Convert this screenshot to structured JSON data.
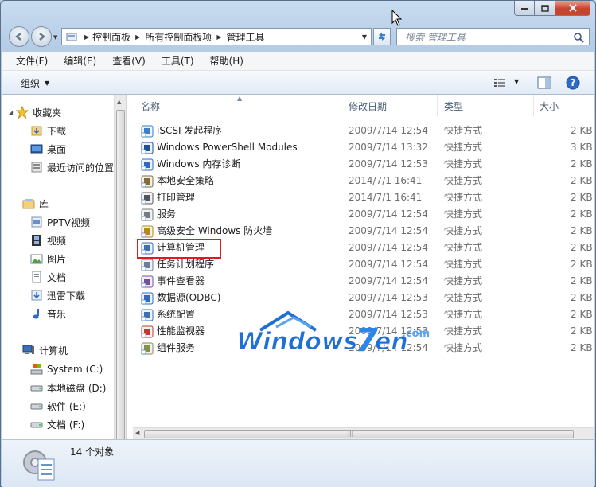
{
  "window": {
    "caption_buttons": [
      {
        "name": "minimize-button",
        "icon": "minimize-icon"
      },
      {
        "name": "maximize-button",
        "icon": "maximize-icon"
      },
      {
        "name": "close-button",
        "icon": "close-icon"
      }
    ]
  },
  "navigation": {
    "breadcrumb": [
      "控制面板",
      "所有控制面板项",
      "管理工具"
    ],
    "search_placeholder": "搜索 管理工具"
  },
  "menubar": {
    "items": [
      "文件(F)",
      "编辑(E)",
      "查看(V)",
      "工具(T)",
      "帮助(H)"
    ]
  },
  "commandbar": {
    "organize_label": "组织"
  },
  "navpane": {
    "favorites": {
      "label": "收藏夹",
      "items": [
        "下载",
        "桌面",
        "最近访问的位置"
      ]
    },
    "libraries": {
      "label": "库",
      "items": [
        "PPTV视频",
        "视频",
        "图片",
        "文档",
        "迅雷下载",
        "音乐"
      ]
    },
    "computer": {
      "label": "计算机",
      "items": [
        "System (C:)",
        "本地磁盘 (D:)",
        "软件 (E:)",
        "文档 (F:)"
      ]
    }
  },
  "filelist": {
    "columns": [
      "名称",
      "修改日期",
      "类型",
      "大小"
    ],
    "rows": [
      {
        "name": "iSCSI 发起程序",
        "date": "2009/7/14 12:54",
        "type": "快捷方式",
        "size": "2 KB",
        "icon": "iscsi-icon"
      },
      {
        "name": "Windows PowerShell Modules",
        "date": "2009/7/14 13:32",
        "type": "快捷方式",
        "size": "3 KB",
        "icon": "powershell-icon"
      },
      {
        "name": "Windows 内存诊断",
        "date": "2009/7/14 12:53",
        "type": "快捷方式",
        "size": "2 KB",
        "icon": "memory-diagnostic-icon"
      },
      {
        "name": "本地安全策略",
        "date": "2014/7/1 16:41",
        "type": "快捷方式",
        "size": "2 KB",
        "icon": "security-policy-icon"
      },
      {
        "name": "打印管理",
        "date": "2014/7/1 16:41",
        "type": "快捷方式",
        "size": "2 KB",
        "icon": "printer-icon"
      },
      {
        "name": "服务",
        "date": "2009/7/14 12:54",
        "type": "快捷方式",
        "size": "2 KB",
        "icon": "services-gear-icon"
      },
      {
        "name": "高级安全 Windows 防火墙",
        "date": "2009/7/14 12:54",
        "type": "快捷方式",
        "size": "2 KB",
        "icon": "firewall-icon"
      },
      {
        "name": "计算机管理",
        "date": "2009/7/14 12:54",
        "type": "快捷方式",
        "size": "2 KB",
        "icon": "computer-management-icon"
      },
      {
        "name": "任务计划程序",
        "date": "2009/7/14 12:54",
        "type": "快捷方式",
        "size": "2 KB",
        "icon": "task-scheduler-icon"
      },
      {
        "name": "事件查看器",
        "date": "2009/7/14 12:54",
        "type": "快捷方式",
        "size": "2 KB",
        "icon": "event-viewer-icon"
      },
      {
        "name": "数据源(ODBC)",
        "date": "2009/7/14 12:53",
        "type": "快捷方式",
        "size": "2 KB",
        "icon": "odbc-icon"
      },
      {
        "name": "系统配置",
        "date": "2009/7/14 12:53",
        "type": "快捷方式",
        "size": "2 KB",
        "icon": "system-config-icon"
      },
      {
        "name": "性能监视器",
        "date": "2009/7/14 12:53",
        "type": "快捷方式",
        "size": "2 KB",
        "icon": "performance-monitor-icon"
      },
      {
        "name": "组件服务",
        "date": "2009/7/14 12:54",
        "type": "快捷方式",
        "size": "2 KB",
        "icon": "component-services-icon"
      }
    ]
  },
  "status": {
    "count_text": "14 个对象"
  },
  "watermark": {
    "text": "Windows7en",
    "suffix": ".com"
  },
  "colors": {
    "highlight_border": "#e21a1a",
    "watermark_blue": "#1f6fd6"
  }
}
